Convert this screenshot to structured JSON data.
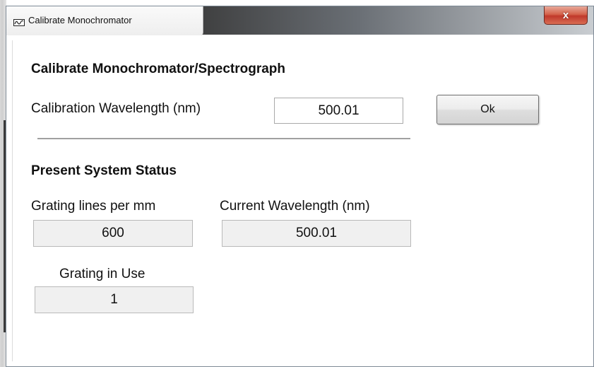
{
  "window": {
    "title": "Calibrate Monochromator",
    "close_label": "x"
  },
  "calibrate": {
    "heading": "Calibrate Monochromator/Spectrograph",
    "wavelength_label": "Calibration Wavelength (nm)",
    "wavelength_value": "500.01",
    "ok_label": "Ok"
  },
  "status": {
    "heading": "Present System Status",
    "grating_lines_label": "Grating lines per mm",
    "grating_lines_value": "600",
    "current_wavelength_label": "Current Wavelength (nm)",
    "current_wavelength_value": "500.01",
    "grating_in_use_label": "Grating in Use",
    "grating_in_use_value": "1"
  }
}
